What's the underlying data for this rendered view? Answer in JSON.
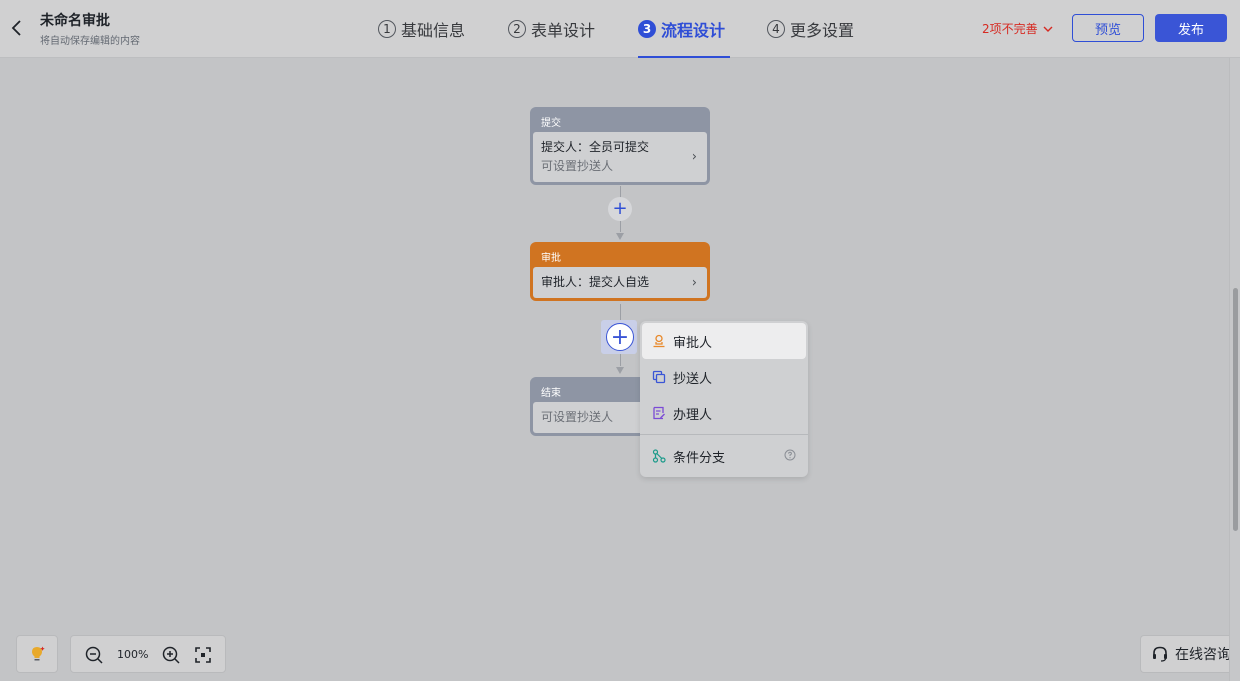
{
  "header": {
    "title": "未命名审批",
    "subtitle": "将自动保存编辑的内容",
    "steps": [
      {
        "num": "1",
        "label": "基础信息"
      },
      {
        "num": "2",
        "label": "表单设计"
      },
      {
        "num": "3",
        "label": "流程设计"
      },
      {
        "num": "4",
        "label": "更多设置"
      }
    ],
    "active_step": 3,
    "warning": "2项不完善",
    "preview_label": "预览",
    "publish_label": "发布"
  },
  "flow": {
    "submit": {
      "head": "提交",
      "line1": "提交人：全员可提交",
      "line2": "可设置抄送人"
    },
    "approve": {
      "head": "审批",
      "line1": "审批人：提交人自选"
    },
    "end": {
      "head": "结束",
      "line1": "可设置抄送人"
    }
  },
  "add_menu": {
    "items": [
      {
        "label": "审批人",
        "icon": "approver-icon",
        "color": "#e8892b"
      },
      {
        "label": "抄送人",
        "icon": "cc-icon",
        "color": "#3a55d6"
      },
      {
        "label": "办理人",
        "icon": "handler-icon",
        "color": "#7b4ad6"
      }
    ],
    "branch": {
      "label": "条件分支",
      "icon": "branch-icon",
      "color": "#1b9a8a"
    }
  },
  "zoom": {
    "value": "100%"
  },
  "consult_label": "在线咨询",
  "colors": {
    "accent": "#2f4ed6",
    "approve_node": "#d07421",
    "neutral_node": "#8e95a4",
    "warning": "#d62a22"
  }
}
